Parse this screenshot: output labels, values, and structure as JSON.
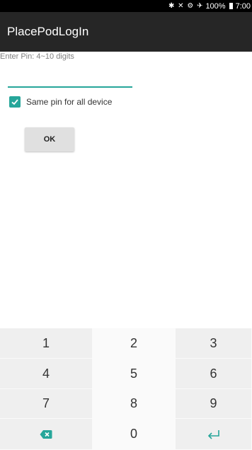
{
  "status_bar": {
    "icons": "✱ ✕ ⚙ ✈",
    "battery": "100%",
    "time": "7:00"
  },
  "app_bar": {
    "title": "PlacePodLogIn"
  },
  "form": {
    "pin_label": "Enter Pin: 4~10 digits",
    "pin_value": "",
    "same_pin_label": "Same pin for all device",
    "same_pin_checked": true,
    "ok_label": "OK"
  },
  "keypad": {
    "keys": [
      "1",
      "2",
      "3",
      "4",
      "5",
      "6",
      "7",
      "8",
      "9"
    ],
    "zero": "0",
    "backspace_icon": "backspace-icon",
    "enter_icon": "enter-icon"
  },
  "colors": {
    "accent": "#26a69a",
    "app_bar": "#262626",
    "button": "#e0e0e0"
  }
}
